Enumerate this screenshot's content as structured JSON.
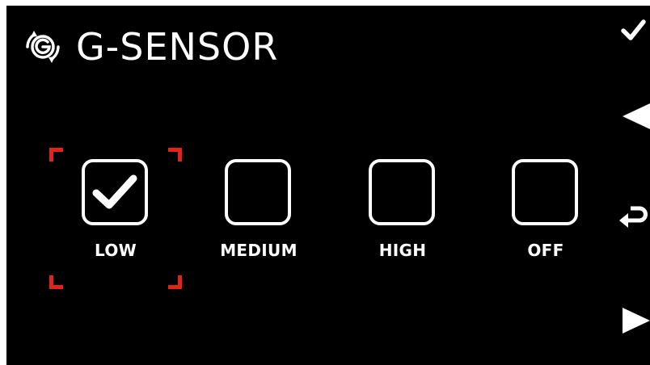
{
  "header": {
    "title": "G-SENSOR",
    "icon": "g-sensor-logo-icon"
  },
  "options": [
    {
      "label": "LOW",
      "checked": true
    },
    {
      "label": "MEDIUM",
      "checked": false
    },
    {
      "label": "HIGH",
      "checked": false
    },
    {
      "label": "OFF",
      "checked": false
    }
  ],
  "selection": {
    "focused_option": "LOW",
    "focus_color": "#e2231a"
  },
  "side_buttons": [
    {
      "icon": "confirm-check-icon"
    },
    {
      "icon": "left-arrow-icon"
    },
    {
      "icon": "back-return-icon"
    },
    {
      "icon": "right-arrow-icon"
    }
  ],
  "colors": {
    "background": "#000000",
    "foreground": "#ffffff",
    "focus": "#e2231a"
  }
}
